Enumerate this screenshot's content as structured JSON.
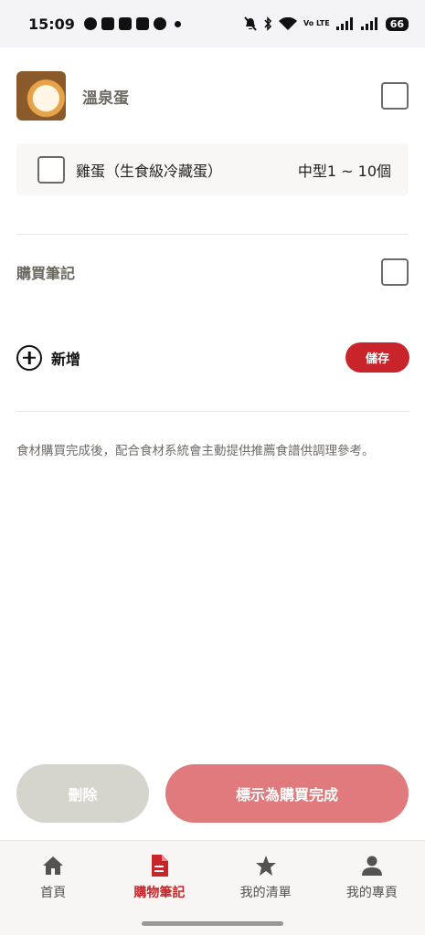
{
  "status_bar": {
    "time": "15:09",
    "volte": "Vo LTE",
    "battery": "66"
  },
  "item": {
    "title": "溫泉蛋",
    "checked": false
  },
  "ingredient": {
    "name": "雞蛋（生食級冷藏蛋）",
    "quantity": "中型1 ~ 10個",
    "checked": false
  },
  "notes": {
    "title": "購買筆記",
    "checked": false
  },
  "add": {
    "label": "新增",
    "save_label": "儲存"
  },
  "info_text": "食材購買完成後，配合食材系統會主動提供推薦食譜供調理參考。",
  "actions": {
    "delete_label": "刪除",
    "complete_label": "標示為購買完成"
  },
  "tabbar": {
    "tabs": [
      {
        "label": "首頁",
        "icon": "home-icon",
        "active": false
      },
      {
        "label": "購物筆記",
        "icon": "document-icon",
        "active": true
      },
      {
        "label": "我的清單",
        "icon": "star-icon",
        "active": false
      },
      {
        "label": "我的專頁",
        "icon": "person-icon",
        "active": false
      }
    ]
  },
  "colors": {
    "accent": "#c8242a",
    "complete_button": "#e07a7c",
    "delete_button": "#d5d4cd",
    "tab_icon": "#55534f"
  }
}
